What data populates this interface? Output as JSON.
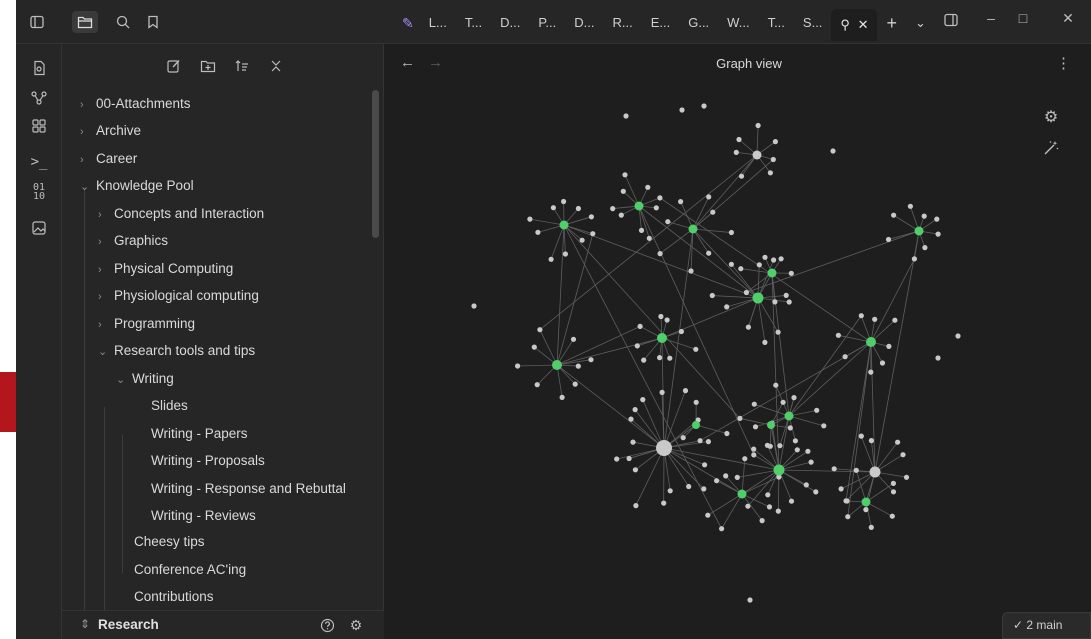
{
  "titlebar": {
    "tabs": [
      "L...",
      "T...",
      "D...",
      "P...",
      "D...",
      "R...",
      "E...",
      "G...",
      "W...",
      "T...",
      "S..."
    ],
    "new_tab": "+",
    "tab_list": "⌄"
  },
  "sidebar": {
    "tree": [
      {
        "label": "00-Attachments",
        "depth": 0,
        "state": "collapsed"
      },
      {
        "label": "Archive",
        "depth": 0,
        "state": "collapsed"
      },
      {
        "label": "Career",
        "depth": 0,
        "state": "collapsed"
      },
      {
        "label": "Knowledge Pool",
        "depth": 0,
        "state": "expanded"
      },
      {
        "label": "Concepts and Interaction",
        "depth": 1,
        "state": "collapsed"
      },
      {
        "label": "Graphics",
        "depth": 1,
        "state": "collapsed"
      },
      {
        "label": "Physical Computing",
        "depth": 1,
        "state": "collapsed"
      },
      {
        "label": "Physiological computing",
        "depth": 1,
        "state": "collapsed"
      },
      {
        "label": "Programming",
        "depth": 1,
        "state": "collapsed"
      },
      {
        "label": "Research tools and tips",
        "depth": 1,
        "state": "expanded"
      },
      {
        "label": "Writing",
        "depth": 2,
        "state": "expanded"
      },
      {
        "label": "Slides",
        "depth": 3,
        "state": "file"
      },
      {
        "label": "Writing - Papers",
        "depth": 3,
        "state": "file"
      },
      {
        "label": "Writing - Proposals",
        "depth": 3,
        "state": "file"
      },
      {
        "label": "Writing - Response and Rebuttal",
        "depth": 3,
        "state": "file"
      },
      {
        "label": "Writing - Reviews",
        "depth": 3,
        "state": "file"
      },
      {
        "label": "Cheesy tips",
        "depth": 2,
        "state": "file"
      },
      {
        "label": "Conference AC'ing",
        "depth": 2,
        "state": "file"
      },
      {
        "label": "Contributions",
        "depth": 2,
        "state": "file"
      }
    ],
    "vault_name": "Research"
  },
  "main": {
    "title": "Graph view"
  },
  "status": {
    "text": "✓ 2  main"
  },
  "colors": {
    "node": "#c9c9c9",
    "node_highlight": "#4fcf6a",
    "edge": "#5e5e5e",
    "arrow": "#b3161d"
  }
}
